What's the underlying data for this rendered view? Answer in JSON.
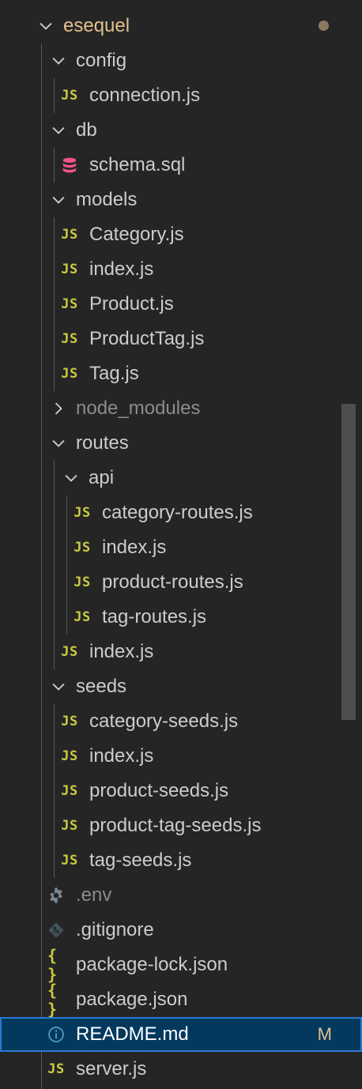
{
  "explorer": {
    "root": {
      "label": "esequel"
    },
    "config": {
      "label": "config",
      "children": [
        "connection.js"
      ]
    },
    "db": {
      "label": "db",
      "children": [
        "schema.sql"
      ]
    },
    "models": {
      "label": "models",
      "children": [
        "Category.js",
        "index.js",
        "Product.js",
        "ProductTag.js",
        "Tag.js"
      ]
    },
    "node_modules": {
      "label": "node_modules"
    },
    "routes": {
      "label": "routes",
      "api": {
        "label": "api",
        "children": [
          "category-routes.js",
          "index.js",
          "product-routes.js",
          "tag-routes.js"
        ]
      },
      "children": [
        "index.js"
      ]
    },
    "seeds": {
      "label": "seeds",
      "children": [
        "category-seeds.js",
        "index.js",
        "product-seeds.js",
        "product-tag-seeds.js",
        "tag-seeds.js"
      ]
    },
    "root_files": [
      ".env",
      ".gitignore",
      "package-lock.json",
      "package.json",
      "README.md",
      "server.js"
    ],
    "badges": {
      "readme": "M"
    }
  },
  "icons": {
    "js": "JS",
    "json": "{ }",
    "sql": "database-icon",
    "env": "gear-icon",
    "git": "git-icon",
    "info": "info-icon"
  },
  "colors": {
    "js_yellow": "#cbcb41",
    "sql_pink": "#f55385",
    "modified": "#e2c08d",
    "selection": "#04395e",
    "focus_border": "#2b7ad1"
  }
}
